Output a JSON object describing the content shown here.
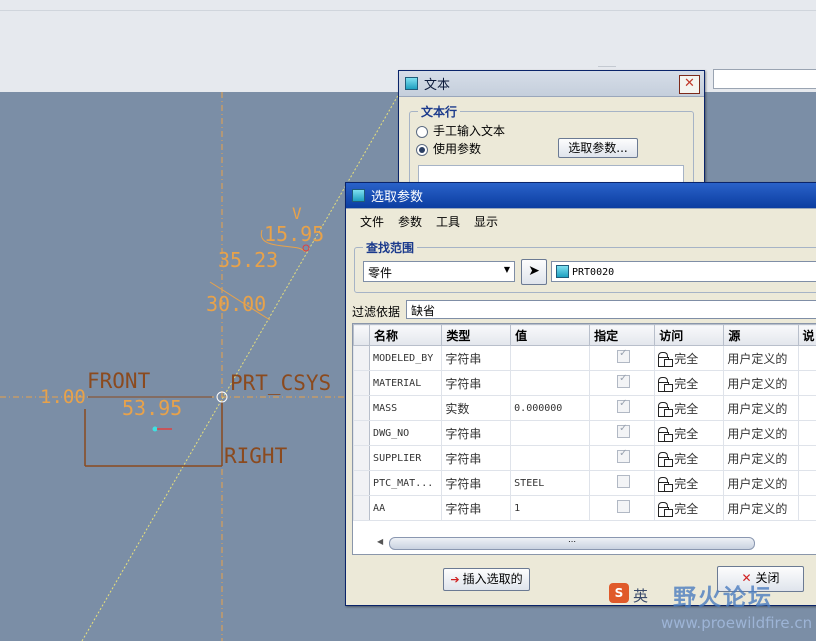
{
  "text_dialog": {
    "title": "文本",
    "group_label": "文本行",
    "option_manual": "手工输入文本",
    "option_param": "使用参数",
    "select_param_button": "选取参数..."
  },
  "model_labels": {
    "v": "V",
    "dim1": "15.95",
    "dim2": "35.23",
    "dim3": "30.00",
    "front": "FRONT",
    "prt_csys": "PRT_CSYS",
    "dim4": "1.00",
    "dim5": "53.95",
    "right": "RIGHT"
  },
  "param_dialog": {
    "title": "选取参数",
    "menu": [
      "文件",
      "参数",
      "工具",
      "显示"
    ],
    "scope_label": "查找范围",
    "scope_value": "零件",
    "scope_item": "PRT0020",
    "filter_label": "过滤依据",
    "filter_value": "缺省",
    "columns": [
      "名称",
      "类型",
      "值",
      "指定",
      "访问",
      "源",
      "说"
    ],
    "rows": [
      {
        "name": "MODELED_BY",
        "type": "字符串",
        "value": "",
        "designate": true,
        "access": "完全",
        "source": "用户定义的"
      },
      {
        "name": "MATERIAL",
        "type": "字符串",
        "value": "",
        "designate": true,
        "access": "完全",
        "source": "用户定义的"
      },
      {
        "name": "MASS",
        "type": "实数",
        "value": "0.000000",
        "designate": true,
        "access": "完全",
        "source": "用户定义的"
      },
      {
        "name": "DWG_NO",
        "type": "字符串",
        "value": "",
        "designate": true,
        "access": "完全",
        "source": "用户定义的"
      },
      {
        "name": "SUPPLIER",
        "type": "字符串",
        "value": "",
        "designate": true,
        "access": "完全",
        "source": "用户定义的"
      },
      {
        "name": "PTC_MAT...",
        "type": "字符串",
        "value": "STEEL",
        "designate": false,
        "access": "完全",
        "source": "用户定义的"
      },
      {
        "name": "AA",
        "type": "字符串",
        "value": "1",
        "designate": false,
        "access": "完全",
        "source": "用户定义的"
      }
    ],
    "insert_button": "插入选取的",
    "close_button": "关闭"
  },
  "watermark": {
    "site_name": "野火论坛",
    "url": "www.proewildfire.cn",
    "ime_label": "英"
  },
  "colors": {
    "canvas_bg": "#7b8ea6",
    "sketch_orange": "#e8a24a",
    "sketch_brown": "#8b4a1e",
    "title_active": "#0b3da1"
  }
}
